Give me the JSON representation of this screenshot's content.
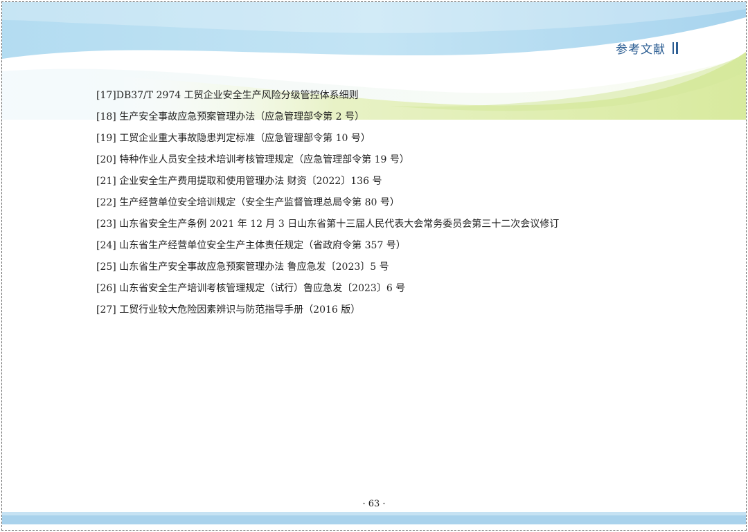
{
  "header": {
    "section_title": "参考文献"
  },
  "references": [
    "[17]DB37/T 2974 工贸企业安全生产风险分级管控体系细则",
    "[18] 生产安全事故应急预案管理办法（应急管理部令第 2 号）",
    "[19] 工贸企业重大事故隐患判定标准（应急管理部令第 10 号）",
    "[20] 特种作业人员安全技术培训考核管理规定（应急管理部令第 19 号）",
    "[21] 企业安全生产费用提取和使用管理办法 财资〔2022〕136 号",
    "[22] 生产经营单位安全培训规定（安全生产监督管理总局令第 80 号）",
    "[23] 山东省安全生产条例 2021 年 12 月 3 日山东省第十三届人民代表大会常务委员会第三十二次会议修订",
    "[24] 山东省生产经营单位安全生产主体责任规定（省政府令第 357 号）",
    "[25] 山东省生产安全事故应急预案管理办法 鲁应急发〔2023〕5 号",
    "[26] 山东省安全生产培训考核管理规定（试行）鲁应急发〔2023〕6 号",
    "[27] 工贸行业较大危险因素辨识与防范指导手册（2016 版）"
  ],
  "footer": {
    "page_number": "· 63 ·"
  },
  "colors": {
    "wave_blue": "#b6dcef",
    "wave_green": "#dfeeb4",
    "title_blue": "#2c5e93",
    "footer_blue": "#a9d2ec"
  }
}
